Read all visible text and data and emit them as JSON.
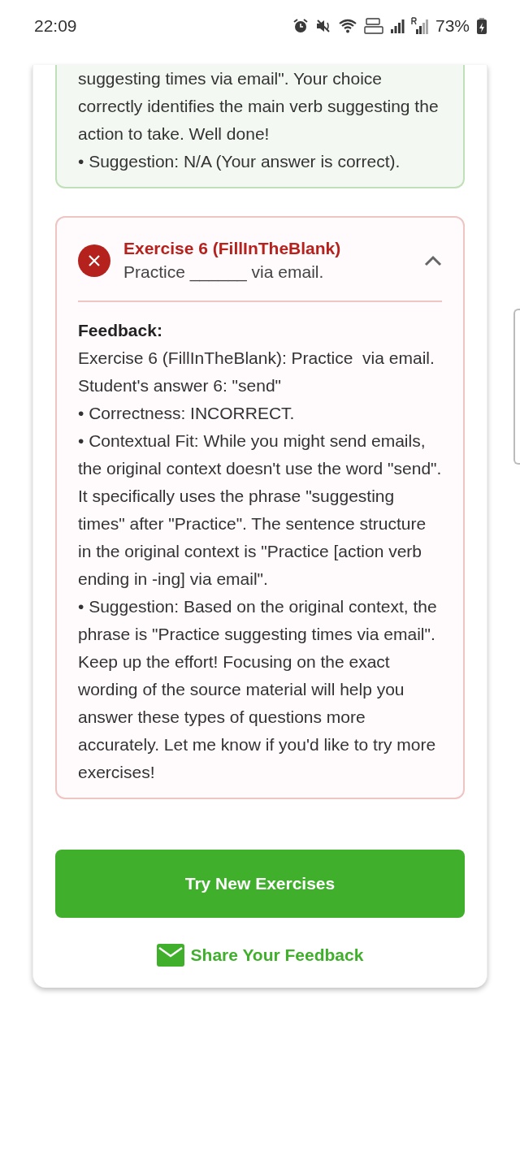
{
  "status_bar": {
    "time": "22:09",
    "battery": "73%"
  },
  "exercises": [
    {
      "kind": "correct",
      "feedback_lines": [
        "suggesting times via email\". Your choice correctly identifies the main verb suggesting the action to take. Well done!",
        "• Suggestion: N/A (Your answer is correct)."
      ]
    },
    {
      "kind": "incorrect",
      "title": "Exercise 6 (FillInTheBlank)",
      "prompt": "Practice ______ via email.",
      "expanded": true,
      "feedback_heading": "Feedback:",
      "feedback_lines": [
        "Exercise 6 (FillInTheBlank): Practice  via email.",
        "Student's answer 6: \"send\"",
        "• Correctness: INCORRECT.",
        "• Contextual Fit: While you might send emails, the original context doesn't use the word \"send\". It specifically uses the phrase \"suggesting times\" after \"Practice\". The sentence structure in the original context is \"Practice [action verb ending in -ing] via email\".",
        "• Suggestion: Based on the original context, the phrase is \"Practice suggesting times via email\".",
        "Keep up the effort! Focusing on the exact wording of the source material will help you answer these types of questions more accurately. Let me know if you'd like to try more exercises!"
      ]
    }
  ],
  "primary_button": "Try New Exercises",
  "share_link": "Share Your Feedback"
}
